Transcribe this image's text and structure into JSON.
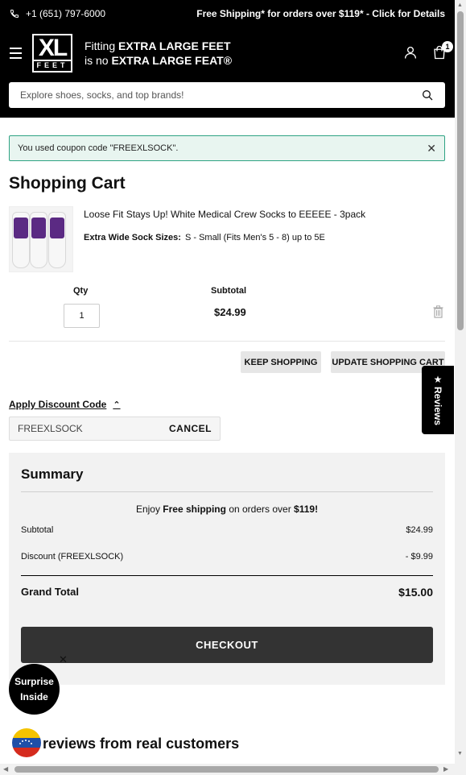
{
  "topbar": {
    "phone": "+1 (651) 797-6000",
    "shipping_text": "Free Shipping* for orders over $119*  - Click for Details"
  },
  "header": {
    "logo_main": "XL",
    "logo_sub": "FEET",
    "tagline_line1_prefix": "Fitting ",
    "tagline_line1_bold": "EXTRA LARGE FEET",
    "tagline_line2_prefix": "is no ",
    "tagline_line2_bold": "EXTRA LARGE FEAT®",
    "cart_count": "1"
  },
  "search": {
    "placeholder": "Explore shoes, socks, and top brands!"
  },
  "notice": {
    "message": "You used coupon code \"FREEXLSOCK\".",
    "close": "✕"
  },
  "page_title": "Shopping Cart",
  "cart_item": {
    "name": "Loose Fit Stays Up! White Medical Crew Socks to EEEEE - 3pack",
    "option_label": "Extra Wide Sock Sizes:",
    "option_value": "S - Small (Fits Men's 5 - 8) up to 5E",
    "qty_label": "Qty",
    "qty": "1",
    "subtotal_label": "Subtotal",
    "subtotal": "$24.99"
  },
  "actions": {
    "keep_shopping": "KEEP SHOPPING",
    "update_cart": "UPDATE SHOPPING CART"
  },
  "reviews_tab": {
    "star": "★",
    "label": "Reviews"
  },
  "discount": {
    "toggle_label": "Apply Discount Code",
    "chevron": "⌃",
    "code_value": "FREEXLSOCK",
    "cancel_label": "CANCEL"
  },
  "summary": {
    "title": "Summary",
    "free_ship_prefix": "Enjoy ",
    "free_ship_bold": "Free shipping",
    "free_ship_mid": " on orders over ",
    "free_ship_amount": "$119!",
    "subtotal_label": "Subtotal",
    "subtotal_value": "$24.99",
    "discount_label": "Discount (FREEXLSOCK)",
    "discount_value": "- $9.99",
    "grand_total_label": "Grand Total",
    "grand_total_value": "$15.00",
    "checkout_label": "CHECKOUT"
  },
  "promo": {
    "surprise_line1": "Surprise",
    "surprise_line2": "Inside",
    "close": "✕"
  },
  "reviews_section": {
    "heading": "reviews from real customers"
  },
  "scroll": {
    "up": "▲",
    "down": "▼",
    "left": "◀",
    "right": "▶"
  }
}
